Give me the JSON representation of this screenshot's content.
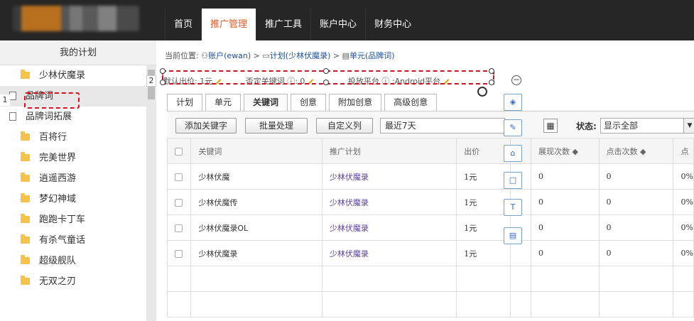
{
  "nav": {
    "items": [
      "首页",
      "推广管理",
      "推广工具",
      "账户中心",
      "财务中心"
    ],
    "active_index": 1
  },
  "sidebar": {
    "header": "我的计划",
    "items": [
      {
        "label": "少林伏魔录",
        "icon": "folder-icon"
      },
      {
        "label": "品牌词",
        "icon": "document-icon",
        "sub": true,
        "selected": true
      },
      {
        "label": "品牌词拓展",
        "icon": "document-icon",
        "sub": true
      },
      {
        "label": "百将行",
        "icon": "folder-icon"
      },
      {
        "label": "完美世界",
        "icon": "folder-icon"
      },
      {
        "label": "逍遥西游",
        "icon": "folder-icon"
      },
      {
        "label": "梦幻神域",
        "icon": "folder-icon"
      },
      {
        "label": "跑跑卡丁车",
        "icon": "folder-icon"
      },
      {
        "label": "有杀气童话",
        "icon": "folder-icon"
      },
      {
        "label": "超级舰队",
        "icon": "folder-icon"
      },
      {
        "label": "无双之刃",
        "icon": "folder-icon"
      }
    ]
  },
  "breadcrumb": {
    "prefix": "当前位置:",
    "account": "账户(ewan)",
    "sep1": ">",
    "plan": "计划(少林伏魔录)",
    "sep2": ">",
    "unit": "单元(品牌词)"
  },
  "info": {
    "bid": "默认出价: 1元",
    "negative": "否定关键词 ⓘ: 0",
    "platform": "投放平台 ⓘ :Android平台"
  },
  "markers": {
    "one": "1",
    "two": "2"
  },
  "tabs": [
    "计划",
    "单元",
    "关键词",
    "创意",
    "附加创意",
    "高级创意"
  ],
  "toolbar": {
    "add": "添加关键字",
    "batch": "批量处理",
    "custom": "自定义列",
    "range": "最近7天",
    "status_label": "状态:",
    "status_value": "显示全部"
  },
  "table": {
    "headers": [
      "关键词",
      "推广计划",
      "出价",
      "展现次数 ◆",
      "点击次数 ◆",
      "点"
    ],
    "rows": [
      [
        "少林伏魔",
        "少林伏魔录",
        "1元",
        "0",
        "0",
        "0%"
      ],
      [
        "少林伏魔传",
        "少林伏魔录",
        "1元",
        "0",
        "0",
        "0%"
      ],
      [
        "少林伏魔录OL",
        "少林伏魔录",
        "1元",
        "0",
        "0",
        "0%"
      ],
      [
        "少林伏魔录",
        "少林伏魔录",
        "1元",
        "0",
        "0",
        "0%"
      ]
    ]
  },
  "float_tools": [
    "layers-icon",
    "pen-icon",
    "eraser-icon",
    "rectangle-icon",
    "text-icon",
    "text-box-icon"
  ],
  "colors": {
    "topbar": "#262626",
    "accent": "#f05a24",
    "link": "#1e50a2",
    "plan": "#5a3fa0",
    "annotation": "#e20b1b"
  }
}
